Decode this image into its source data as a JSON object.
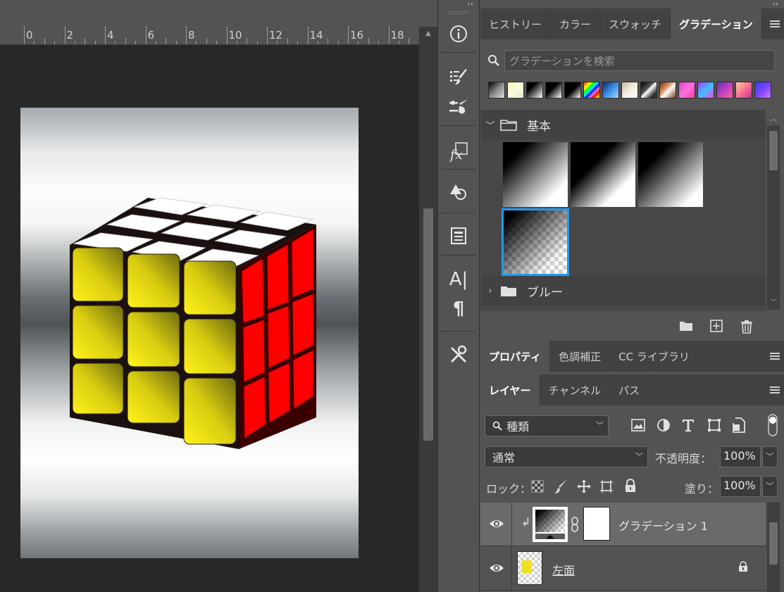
{
  "ruler": {
    "labels": [
      "0",
      "2",
      "4",
      "6",
      "8",
      "10",
      "12",
      "14",
      "16",
      "18"
    ]
  },
  "tool_strip": {
    "collapse": "‹‹",
    "tools": [
      "info-icon",
      "brush-settings-icon",
      "adjust-brushes-icon",
      "fx-icon",
      "shape-history-icon",
      "notes-icon",
      "character-icon",
      "paragraph-icon",
      "tools-icon"
    ],
    "character_label": "A|",
    "paragraph_label": "¶",
    "fx_label": "fx"
  },
  "panels": {
    "collapse": "››",
    "top_tabs": [
      {
        "label": "ヒストリー",
        "active": false
      },
      {
        "label": "カラー",
        "active": false
      },
      {
        "label": "スウォッチ",
        "active": false
      },
      {
        "label": "グラデーション",
        "active": true
      }
    ],
    "gradients": {
      "search_placeholder": "グラデーションを検索",
      "folders": [
        {
          "label": "基本",
          "expanded": true
        },
        {
          "label": "ブルー",
          "expanded": false
        }
      ],
      "selected_index": 3
    },
    "mid_tabs": [
      {
        "label": "プロパティ",
        "active": true
      },
      {
        "label": "色調補正",
        "active": false
      },
      {
        "label": "CC ライブラリ",
        "active": false
      }
    ],
    "layer_tabs": [
      {
        "label": "レイヤー",
        "active": true
      },
      {
        "label": "チャンネル",
        "active": false
      },
      {
        "label": "パス",
        "active": false
      }
    ],
    "layers": {
      "filter_kind": "種類",
      "blend_mode": "通常",
      "opacity_label": "不透明度：",
      "opacity_value": "100%",
      "lock_label": "ロック：",
      "fill_label": "塗り：",
      "fill_value": "100%",
      "items": [
        {
          "name": "グラデーション 1",
          "selected": true,
          "visible": true,
          "locked": false
        },
        {
          "name": "左面",
          "selected": false,
          "visible": true,
          "locked": true
        }
      ]
    }
  },
  "colors": {
    "panel_bg": "#535353",
    "canvas_bg": "#282828",
    "selection_blue": "#1d9bf0"
  }
}
